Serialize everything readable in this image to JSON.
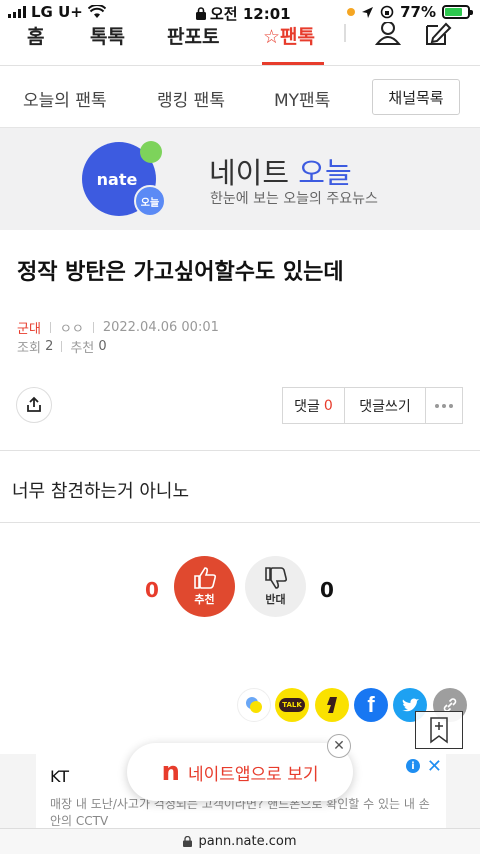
{
  "status_bar": {
    "carrier": "LG U+",
    "time": "오전 12:01",
    "battery": "77%"
  },
  "top_nav": {
    "tabs": [
      "홈",
      "톡톡",
      "판포토",
      "☆팬톡"
    ],
    "active_tab": "☆팬톡"
  },
  "sub_nav": {
    "items": [
      "오늘의 팬톡",
      "랭킹 팬톡",
      "MY팬톡"
    ],
    "channel_button": "채널목록"
  },
  "banner": {
    "logo_text": "nate",
    "logo_badge": "오늘",
    "title_prefix": "네이트 ",
    "title_accent": "오늘",
    "subtitle": "한눈에 보는 오늘의 주요뉴스"
  },
  "article": {
    "title": "정작 방탄은 가고싶어할수도 있는데",
    "category": "군대",
    "author": "ㅇㅇ",
    "date": "2022.04.06 00:01",
    "views_label": "조회",
    "views": "2",
    "recommend_label": "추천",
    "recommend": "0",
    "body": "너무 참견하는거 아니노"
  },
  "comments": {
    "label": "댓글",
    "count": "0",
    "write_label": "댓글쓰기"
  },
  "votes": {
    "up_label": "추천",
    "up_count": "0",
    "down_label": "반대",
    "down_count": "0"
  },
  "social": {
    "kakao_talk_label": "TALK",
    "facebook_label": "f"
  },
  "ad": {
    "title": "KT",
    "body": "매장 내 도난/사고가 걱정되는 고객이라면? 핸드폰으로 확인할 수 있는 내 손안의 CCTV"
  },
  "app_button": {
    "logo": "n",
    "label": "네이트앱으로 보기"
  },
  "url_bar": {
    "url": "pann.nate.com"
  },
  "colors": {
    "accent": "#e73c2c",
    "nate_blue": "#3d5be0",
    "facebook": "#1877f2",
    "twitter": "#1da1f2",
    "kakao": "#fae100"
  }
}
